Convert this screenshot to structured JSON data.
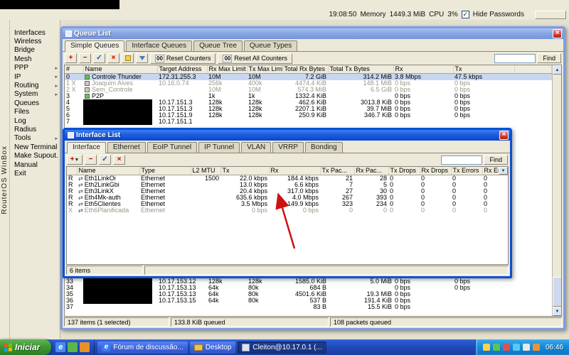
{
  "colors": {
    "titlebar_active": "#1e5ede",
    "titlebar_inactive": "#8aa6e4",
    "selection": "#c8d7f1",
    "taskbar_blue": "#1e49b8",
    "start_button_green": "#3d9a32",
    "annotation_arrow_red": "#cc1111",
    "window_chrome": "#ece9d8"
  },
  "topbar": {
    "time": "19:08:50",
    "memory_label": "Memory",
    "memory_value": "1449.3 MiB",
    "cpu_label": "CPU",
    "cpu_value": "3%",
    "hide_passwords_label": "Hide Passwords",
    "hide_passwords_checked": true
  },
  "sidebar": {
    "brand": "RouterOS WinBox",
    "items": [
      {
        "label": "Interfaces",
        "arrow": false
      },
      {
        "label": "Wireless",
        "arrow": false
      },
      {
        "label": "Bridge",
        "arrow": false
      },
      {
        "label": "Mesh",
        "arrow": false
      },
      {
        "label": "PPP",
        "arrow": true
      },
      {
        "label": "IP",
        "arrow": true
      },
      {
        "label": "Routing",
        "arrow": true
      },
      {
        "label": "System",
        "arrow": true
      },
      {
        "label": "Queues",
        "arrow": false
      },
      {
        "label": "Files",
        "arrow": false
      },
      {
        "label": "Log",
        "arrow": false
      },
      {
        "label": "Radius",
        "arrow": false
      },
      {
        "label": "Tools",
        "arrow": true
      },
      {
        "label": "New Terminal",
        "arrow": false
      },
      {
        "label": "Make Supout.rif",
        "arrow": false
      },
      {
        "label": "Manual",
        "arrow": false
      },
      {
        "label": "Exit",
        "arrow": false
      }
    ]
  },
  "queue_window": {
    "title": "Queue List",
    "tabs": [
      "Simple Queues",
      "Interface Queues",
      "Queue Tree",
      "Queue Types"
    ],
    "active_tab": "Simple Queues",
    "toolbar": {
      "reset_counters_icon": "00",
      "reset_counters": "Reset Counters",
      "reset_all_icon": "00",
      "reset_all": "Reset All Counters",
      "find_label": "Find"
    },
    "columns": [
      "#",
      "Name",
      "Target Address",
      "Rx Max Limit",
      "Tx Max Limit",
      "Total Rx Bytes",
      "Total Tx Bytes",
      "Rx",
      "Tx"
    ],
    "rows_top": [
      {
        "num": "0",
        "flag": "",
        "icon": "green",
        "name": "Controle Thunder",
        "target": "172.31.255.3",
        "rxmax": "10M",
        "txmax": "10M",
        "totrx": "7.2 GiB",
        "tottx": "314.2 MiB",
        "rx": "3.8 Mbps",
        "tx": "47.5 kbps",
        "selected": true
      },
      {
        "num": "1",
        "flag": "X",
        "icon": "gray",
        "name": "Joaquim Alves",
        "target": "10.16.0.74",
        "rxmax": "256k",
        "txmax": "400k",
        "totrx": "4474.4 KiB",
        "tottx": "148.1 MiB",
        "rx": "0 bps",
        "tx": "0 bps",
        "disabled": true
      },
      {
        "num": "2",
        "flag": "X",
        "icon": "gray",
        "name": "Sem_Controle",
        "target": "",
        "rxmax": "10M",
        "txmax": "10M",
        "totrx": "574.3 MiB",
        "tottx": "6.5 GiB",
        "rx": "0 bps",
        "tx": "0 bps",
        "disabled": true
      },
      {
        "num": "3",
        "flag": "",
        "icon": "green",
        "name": "P2P",
        "target": "",
        "rxmax": "1k",
        "txmax": "1k",
        "totrx": "1332.4 KiB",
        "tottx": "",
        "rx": "0 bps",
        "tx": "0 bps"
      },
      {
        "num": "4",
        "redacted": true,
        "target": "10.17.151.3",
        "rxmax": "128k",
        "txmax": "128k",
        "totrx": "462.6 KiB",
        "tottx": "3013.8 KiB",
        "rx": "0 bps",
        "tx": "0 bps"
      },
      {
        "num": "5",
        "redacted": true,
        "target": "10.17.151.3",
        "rxmax": "128k",
        "txmax": "128k",
        "totrx": "2207.1 KiB",
        "tottx": "39.7 MiB",
        "rx": "0 bps",
        "tx": "0 bps"
      },
      {
        "num": "6",
        "redacted": true,
        "target": "10.17.151.9",
        "rxmax": "128k",
        "txmax": "128k",
        "totrx": "250.9 KiB",
        "tottx": "346.7 KiB",
        "rx": "0 bps",
        "tx": "0 bps"
      },
      {
        "num": "7",
        "redacted": true,
        "target": "10.17.151.1",
        "rxmax": "",
        "txmax": "",
        "totrx": "",
        "tottx": "",
        "rx": "",
        "tx": ""
      }
    ],
    "rows_bottom": [
      {
        "num": "33",
        "redacted": true,
        "target": "10.17.153.12",
        "rxmax": "128k",
        "txmax": "128k",
        "totrx": "1585.0 KiB",
        "tottx": "5.0 MiB",
        "rx": "0 bps",
        "tx": "0 bps"
      },
      {
        "num": "34",
        "redacted": true,
        "target": "10.17.153.13",
        "rxmax": "64k",
        "txmax": "80k",
        "totrx": "684 B",
        "tottx": "",
        "rx": "0 bps",
        "tx": "0 bps"
      },
      {
        "num": "35",
        "redacted": true,
        "target": "10.17.153.13",
        "rxmax": "64k",
        "txmax": "80k",
        "totrx": "4501.6 KiB",
        "tottx": "19.3 MiB",
        "rx": "0 bps",
        "tx": ""
      },
      {
        "num": "36",
        "redacted": true,
        "target": "10.17.153.15",
        "rxmax": "64k",
        "txmax": "80k",
        "totrx": "537 B",
        "tottx": "191.4 KiB",
        "rx": "0 bps",
        "tx": ""
      },
      {
        "num": "37",
        "flag": "",
        "name": "",
        "target": "",
        "rxmax": "",
        "txmax": "",
        "totrx": "83 B",
        "tottx": "15.5 KiB",
        "rx": "0 bps",
        "tx": ""
      }
    ],
    "status_items": "137 items (1 selected)",
    "status_queued": "133.8 KiB queued",
    "status_packets": "108 packets queued"
  },
  "interface_window": {
    "title": "Interface List",
    "tabs": [
      "Interface",
      "Ethernet",
      "EoIP Tunnel",
      "IP Tunnel",
      "VLAN",
      "VRRP",
      "Bonding"
    ],
    "active_tab": "Interface",
    "find_label": "Find",
    "columns": [
      "",
      "Name",
      "Type",
      "L2 MTU",
      "Tx",
      "Rx",
      "Tx Pac...",
      "Rx Pac...",
      "Tx Drops",
      "Rx Drops",
      "Tx Errors",
      "Rx Errors"
    ],
    "rows": [
      {
        "flag": "R",
        "name": "Eth1LinkOi",
        "type": "Ethernet",
        "l2mtu": "1500",
        "tx": "22.0 kbps",
        "rx": "184.4 kbps",
        "txp": "21",
        "rxp": "28",
        "txd": "0",
        "rxd": "0",
        "txe": "0",
        "rxe": "0"
      },
      {
        "flag": "R",
        "name": "Eth2LinkGbi",
        "type": "Ethernet",
        "l2mtu": "",
        "tx": "13.0 kbps",
        "rx": "6.6 kbps",
        "txp": "7",
        "rxp": "5",
        "txd": "0",
        "rxd": "0",
        "txe": "0",
        "rxe": "0"
      },
      {
        "flag": "R",
        "name": "Eth3LinkX",
        "type": "Ethernet",
        "l2mtu": "",
        "tx": "20.4 kbps",
        "rx": "317.0 kbps",
        "txp": "27",
        "rxp": "30",
        "txd": "0",
        "rxd": "0",
        "txe": "0",
        "rxe": "0"
      },
      {
        "flag": "R",
        "name": "Eth4Mk-auth",
        "type": "Ethernet",
        "l2mtu": "",
        "tx": "635.6 kbps",
        "rx": "4.0 Mbps",
        "txp": "267",
        "rxp": "393",
        "txd": "0",
        "rxd": "0",
        "txe": "0",
        "rxe": "0"
      },
      {
        "flag": "R",
        "name": "Eth5Clientes",
        "type": "Ethernet",
        "l2mtu": "",
        "tx": "3.5 Mbps",
        "rx": "149.9 kbps",
        "txp": "323",
        "rxp": "234",
        "txd": "0",
        "rxd": "0",
        "txe": "0",
        "rxe": "0"
      },
      {
        "flag": "X",
        "name": "Eth6Planificada",
        "type": "Ethernet",
        "l2mtu": "",
        "tx": "0 bps",
        "rx": "0 bps",
        "txp": "0",
        "rxp": "0",
        "txd": "0",
        "rxd": "0",
        "txe": "0",
        "rxe": "0",
        "disabled": true
      }
    ],
    "status": "6 items"
  },
  "taskbar": {
    "start_label": "Iniciar",
    "tasks": [
      {
        "label": "Fórum de discussão...",
        "icon": "ie"
      },
      {
        "label": "Desktop",
        "icon": "folder"
      },
      {
        "label": "Cleiton@10.17.0.1 (...",
        "icon": "winbox",
        "active": true
      }
    ],
    "clock": "06:46"
  }
}
